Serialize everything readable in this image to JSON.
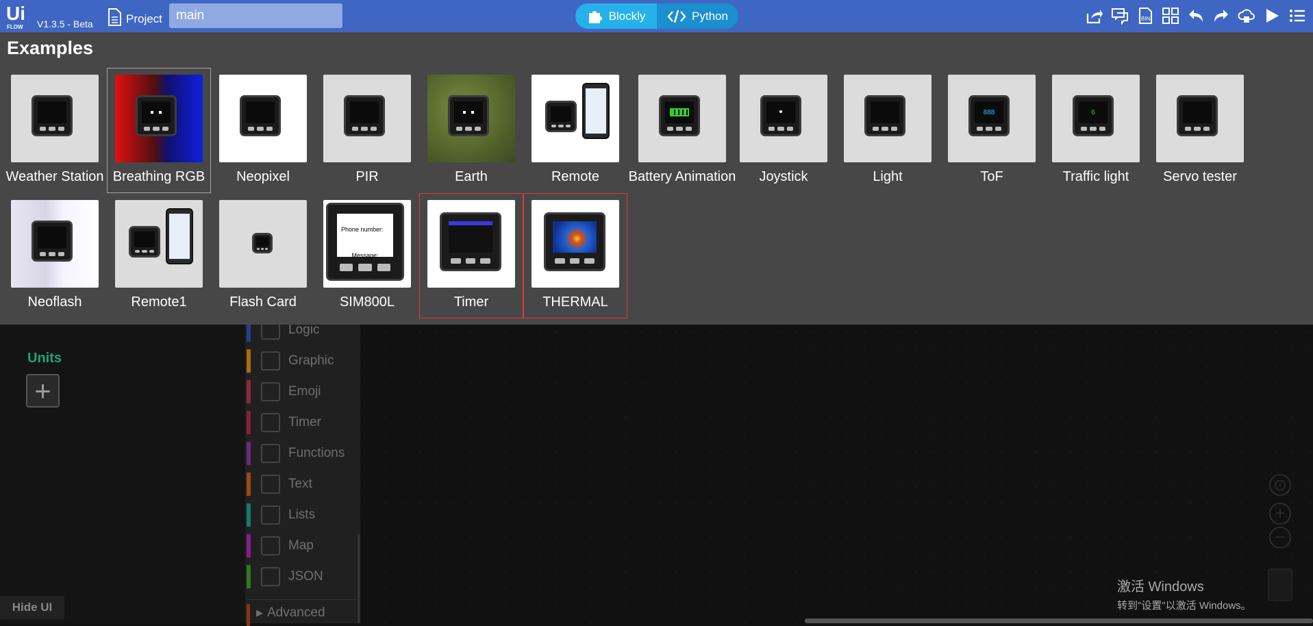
{
  "app": {
    "logo_text": "UI FLOW",
    "version": "V1.3.5 - Beta"
  },
  "topbar": {
    "project_label": "Project",
    "project_name": "main",
    "modes": [
      {
        "label": "Blockly",
        "active": true
      },
      {
        "label": "Python",
        "active": false
      }
    ],
    "icons": [
      "share-icon",
      "comment-icon",
      "document-icon",
      "layout-icon",
      "undo-icon",
      "redo-icon",
      "cloud-icon",
      "run-icon",
      "menu-icon"
    ]
  },
  "examples": {
    "title": "Examples",
    "items": [
      {
        "label": "Weather Station",
        "thumb": "light",
        "screen": "weather"
      },
      {
        "label": "Breathing RGB",
        "thumb": "rgb",
        "screen": "face",
        "selected": true
      },
      {
        "label": "Neopixel",
        "thumb": "white",
        "screen": "strip"
      },
      {
        "label": "PIR",
        "thumb": "light",
        "screen": "pir"
      },
      {
        "label": "Earth",
        "thumb": "plant",
        "screen": "face"
      },
      {
        "label": "Remote",
        "thumb": "white",
        "screen": "phone"
      },
      {
        "label": "Battery Animation",
        "thumb": "light",
        "screen": "battery"
      },
      {
        "label": "Joystick",
        "thumb": "light",
        "screen": "dot"
      },
      {
        "label": "Light",
        "thumb": "light",
        "screen": "daynight"
      },
      {
        "label": "ToF",
        "thumb": "light",
        "screen": "tof"
      },
      {
        "label": "Traffic light",
        "thumb": "light",
        "screen": "count"
      },
      {
        "label": "Servo tester",
        "thumb": "light",
        "screen": "servo"
      },
      {
        "label": "Neoflash",
        "thumb": "flash",
        "screen": "dark"
      },
      {
        "label": "Remote1",
        "thumb": "light",
        "screen": "phone"
      },
      {
        "label": "Flash Card",
        "thumb": "light",
        "screen": "small"
      },
      {
        "label": "SIM800L",
        "thumb": "white",
        "screen": "sim"
      },
      {
        "label": "Timer",
        "thumb": "white",
        "screen": "timer",
        "highlighted": true
      },
      {
        "label": "THERMAL",
        "thumb": "white",
        "screen": "thermal",
        "highlighted": true
      }
    ],
    "sim_text": {
      "phone": "Phone number:",
      "message": "Message:"
    },
    "tof_value": "888",
    "count_value": "6"
  },
  "units": {
    "title": "Units",
    "add_symbol": "+"
  },
  "palette": [
    {
      "label": "Logic",
      "color": "#2a3d8f"
    },
    {
      "label": "Graphic",
      "color": "#a76f12"
    },
    {
      "label": "Emoji",
      "color": "#8a2a3a"
    },
    {
      "label": "Timer",
      "color": "#8a1f3a"
    },
    {
      "label": "Functions",
      "color": "#6b2a7a"
    },
    {
      "label": "Text",
      "color": "#9a4a12"
    },
    {
      "label": "Lists",
      "color": "#147a6e"
    },
    {
      "label": "Map",
      "color": "#8a1c8a"
    },
    {
      "label": "JSON",
      "color": "#2c7a1c"
    }
  ],
  "advanced_label": "Advanced",
  "hide_ui_label": "Hide UI",
  "activate": {
    "line1": "激活 Windows",
    "line2": "转到\"设置\"以激活 Windows。"
  }
}
